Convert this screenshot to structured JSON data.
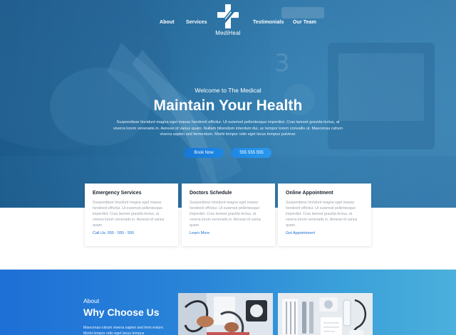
{
  "nav": {
    "links_left": [
      "About",
      "Services"
    ],
    "links_right": [
      "Testimonials",
      "Our Team"
    ],
    "logo_text": "MediHeal"
  },
  "hero": {
    "eyebrow": "Welcome to The Medical",
    "title": "Maintain Your Health",
    "description": "Suspendisse tincidunt magna eget massa hendrerit efficitur. Ut euismod pellentesque imperdiet. Cras laoreet gravida lectus, at viverra lorem venenatis in. Aenean id varius quam. Nullam bibendum interdum dui, ac tempor lorem convallis ut. Maecenas rutrum viverra sapien sed fermentum. Morbi tempor odio eget lacus tempus pulvinar.",
    "button_book": "Book Now",
    "button_phone": "555 555 555"
  },
  "cards": [
    {
      "title": "Emergency Services",
      "text": "Suspendisse tincidunt magna eget massa hendrerit efficitur. Ut euismod pellentesque imperdiet. Cras laoreet gravida lectus, at viverra lorem venenatis in. Aenean id varius quam.",
      "link": "Call Us: 555 - 555 - 555"
    },
    {
      "title": "Doctors Schedule",
      "text": "Suspendisse tincidunt magna eget massa hendrerit efficitur. Ut euismod pellentesque imperdiet. Cras laoreet gravida lectus, at viverra lorem venenatis in. Aenean id varius quam.",
      "link": "Learn More"
    },
    {
      "title": "Online Appointment",
      "text": "Suspendisse tincidunt magna eget massa hendrerit efficitur. Ut euismod pellentesque imperdiet. Cras laoreet gravida lectus, at viverra lorem venenatis in. Aenean id varius quam.",
      "link": "Get Appointment"
    }
  ],
  "about": {
    "eyebrow": "About",
    "title": "Why Choose Us",
    "text": "Maecenas rutrum viverra sapien sed ferm entum. Morbi tempor odio eget lacus tempus"
  },
  "colors": {
    "accent_blue": "#1e88e5",
    "link_blue": "#1f6fcf",
    "hero_blue": "#2b73a4",
    "card_title": "#1b2330",
    "card_text": "#9aa3ad"
  }
}
